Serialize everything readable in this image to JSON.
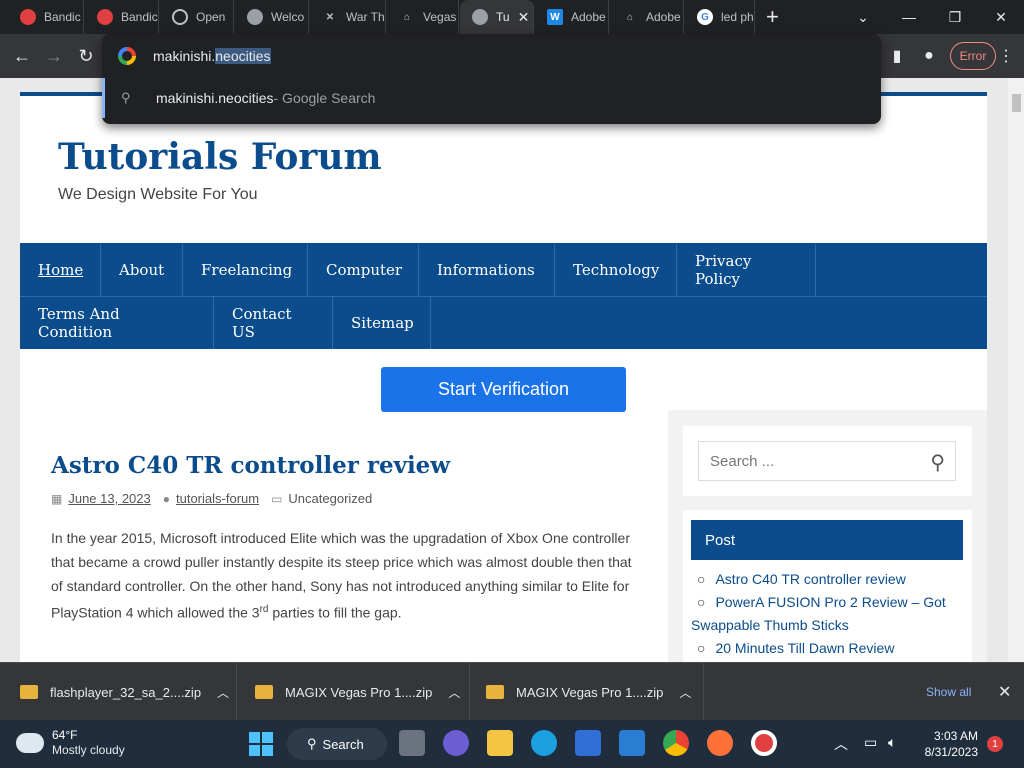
{
  "browser": {
    "tabs": [
      {
        "label": "Bandic",
        "favicon": "bandicam-icon",
        "color": "#e04040"
      },
      {
        "label": "Bandic",
        "favicon": "bandicam-icon",
        "color": "#e04040"
      },
      {
        "label": "Open",
        "favicon": "openai-icon",
        "color": "#bdc1c6"
      },
      {
        "label": "Welco",
        "favicon": "globe-icon",
        "color": "#bdc1c6"
      },
      {
        "label": "War Th",
        "favicon": "sword-icon",
        "color": "#bdc1c6"
      },
      {
        "label": "Vegas",
        "favicon": "building-icon",
        "color": "#bdc1c6"
      },
      {
        "label": "Tu",
        "favicon": "globe-icon",
        "color": "#bdc1c6"
      },
      {
        "label": "Adobe",
        "favicon": "w-icon",
        "color": "#1e88e5"
      },
      {
        "label": "Adobe",
        "favicon": "building-icon",
        "color": "#bdc1c6"
      },
      {
        "label": "led ph",
        "favicon": "google-icon",
        "color": "#4285f4"
      }
    ],
    "omnibox": {
      "typed": "makinishi.",
      "selected": "neocities",
      "suggestion_text": "makinishi.neocities",
      "suggestion_suffix": " - Google Search"
    },
    "error_label": "Error"
  },
  "site": {
    "title": "Tutorials Forum",
    "tagline": "We Design Website For You",
    "nav_row1": [
      "Home",
      "About",
      "Freelancing",
      "Computer",
      "Informations",
      "Technology",
      "Privacy Policy"
    ],
    "nav_row2": [
      "Terms And Condition",
      "Contact US",
      "Sitemap"
    ],
    "verify_button": "Start Verification",
    "post": {
      "title": "Astro C40 TR controller review",
      "date": "June 13, 2023",
      "author": "tutorials-forum",
      "category": "Uncategorized",
      "excerpt_a": "In the year 2015, Microsoft introduced Elite which was the upgradation of Xbox One controller that became a crowd puller instantly despite its steep price which was almost double then that of standard controller. On the other hand, Sony has not introduced anything similar to Elite for PlayStation 4 which allowed the 3",
      "excerpt_sup": "rd",
      "excerpt_b": " parties to fill the gap."
    },
    "sidebar": {
      "search_placeholder": "Search ...",
      "post_heading": "Post",
      "posts": [
        "Astro C40 TR controller review",
        "PowerA FUSION Pro 2 Review – Got Swappable Thumb Sticks",
        "20 Minutes Till Dawn Review"
      ]
    }
  },
  "downloads": {
    "items": [
      "flashplayer_32_sa_2....zip",
      "MAGIX Vegas Pro 1....zip",
      "MAGIX Vegas Pro 1....zip"
    ],
    "show_all": "Show all"
  },
  "taskbar": {
    "temp": "64°F",
    "weather": "Mostly cloudy",
    "search_label": "Search",
    "time": "3:03 AM",
    "date": "8/31/2023",
    "notifications": "1"
  }
}
